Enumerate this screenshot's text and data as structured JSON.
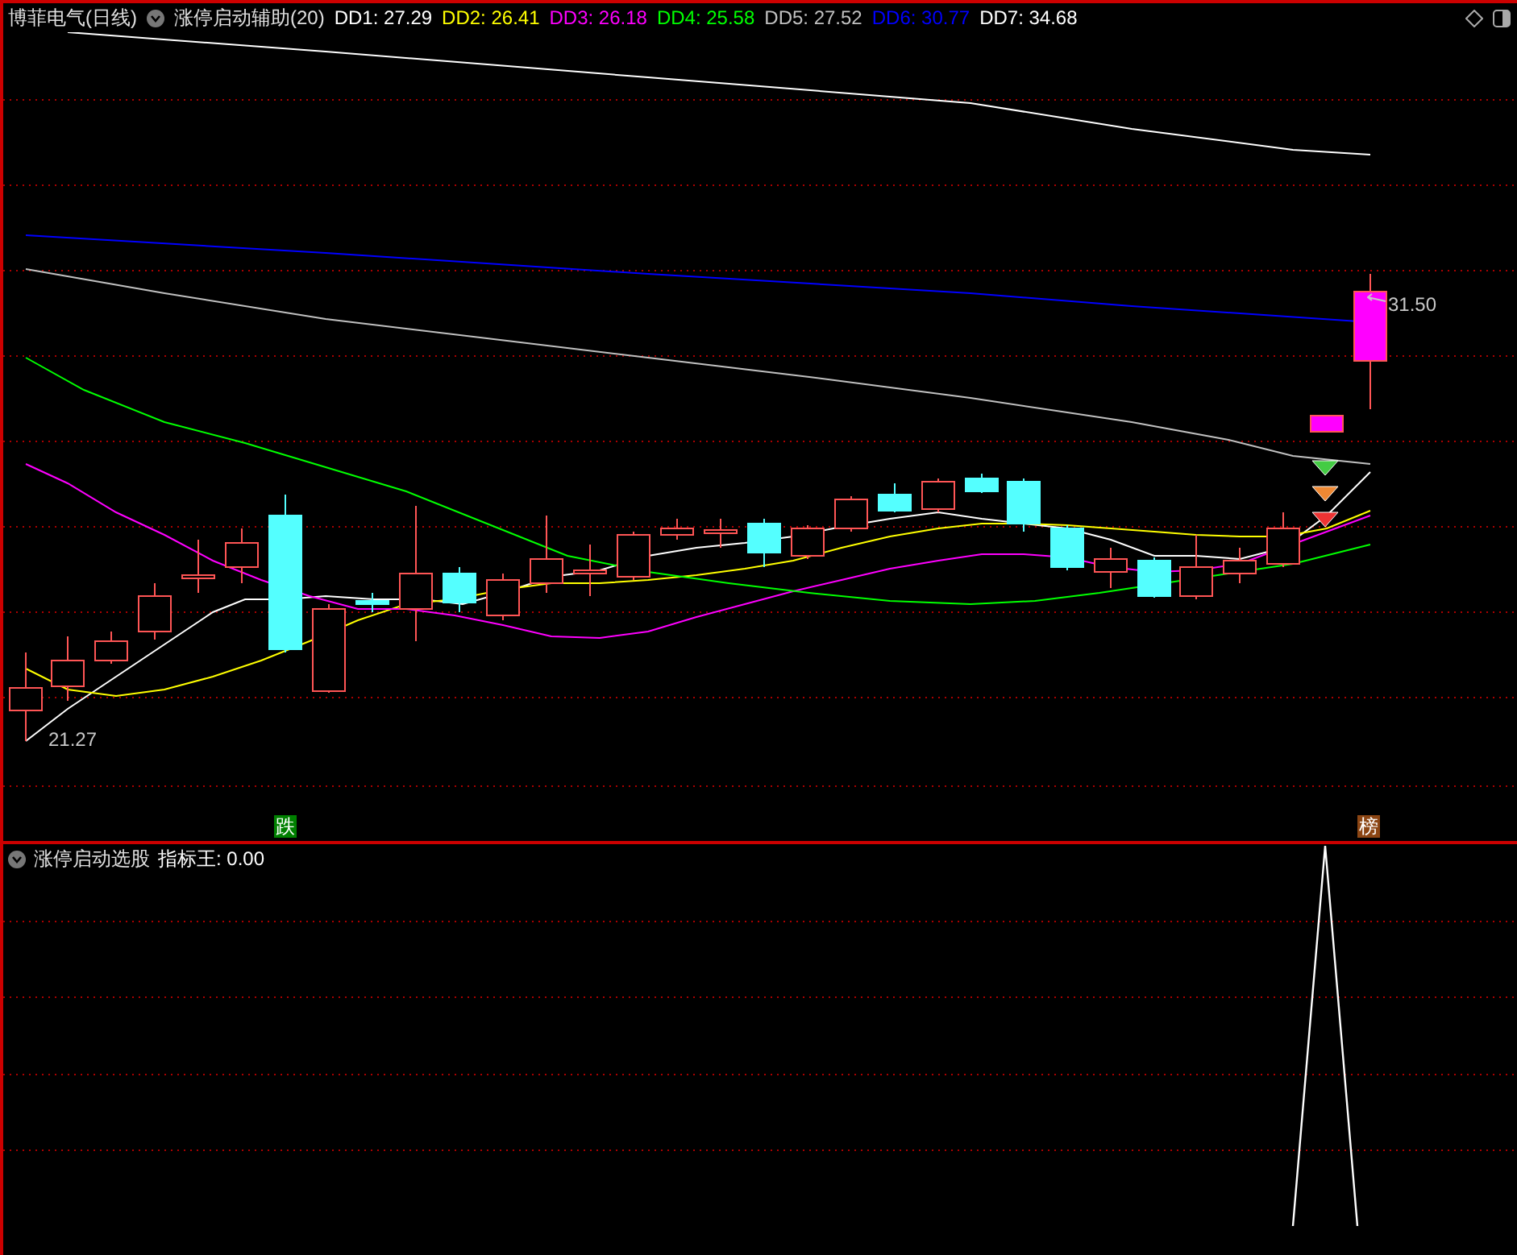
{
  "header": {
    "stock": "博菲电气(日线)",
    "indicator": "涨停启动辅助(20)",
    "legend": [
      {
        "label": "DD1: 27.29",
        "color": "#ffffff"
      },
      {
        "label": "DD2: 26.41",
        "color": "#ffff00"
      },
      {
        "label": "DD3: 26.18",
        "color": "#ff00ff"
      },
      {
        "label": "DD4: 25.58",
        "color": "#00ff00"
      },
      {
        "label": "DD5: 27.52",
        "color": "#c0c0c0"
      },
      {
        "label": "DD6: 30.77",
        "color": "#0000ff"
      },
      {
        "label": "DD7: 34.68",
        "color": "#ffffff"
      }
    ]
  },
  "chart": {
    "high_label": "31.50",
    "low_label": "21.27",
    "signals": [
      {
        "text": "跌",
        "color": "#008000"
      },
      {
        "text": "榜",
        "color": "#8b4513"
      }
    ]
  },
  "sub_panel": {
    "title": "涨停启动选股",
    "reading": "指标王: 0.00"
  }
}
